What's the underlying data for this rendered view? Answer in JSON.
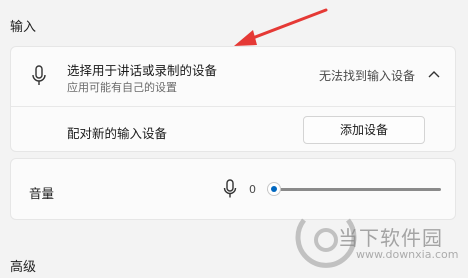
{
  "sections": {
    "input_title": "输入",
    "advanced_title": "高级"
  },
  "device_select": {
    "icon": "microphone-icon",
    "title": "选择用于讲话或录制的设备",
    "subtitle": "应用可能有自己的设置",
    "status": "无法找到输入设备",
    "chevron_icon": "chevron-up-icon"
  },
  "pair_device": {
    "label": "配对新的输入设备",
    "button_label": "添加设备"
  },
  "volume": {
    "label": "音量",
    "icon": "microphone-icon",
    "value": "0",
    "level_fraction": 0
  },
  "colors": {
    "annotation_arrow": "#e53935",
    "accent": "#0067c0"
  },
  "watermark": {
    "text": "当下软件园",
    "url": "www.downxia.com"
  }
}
